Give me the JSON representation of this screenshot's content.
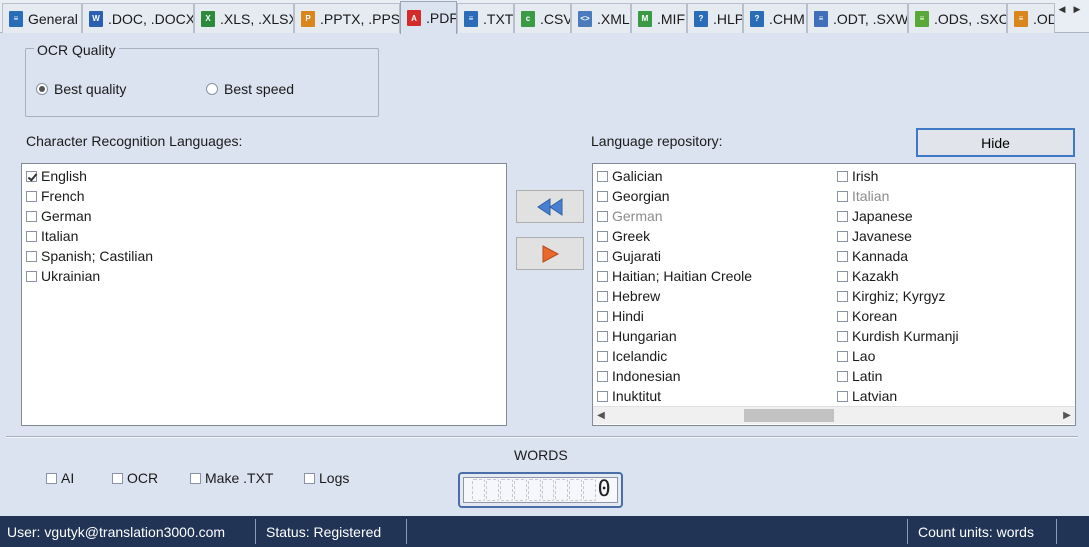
{
  "tabs": [
    {
      "label": "General",
      "icon": "document-icon",
      "color": "#2b6cb8"
    },
    {
      "label": ".DOC, .DOCX",
      "icon": "word-icon",
      "color": "#2b5fb0"
    },
    {
      "label": ".XLS, .XLSX",
      "icon": "excel-icon",
      "color": "#2e8a3c"
    },
    {
      "label": ".PPTX, .PPSX",
      "icon": "powerpoint-icon",
      "color": "#d9861c"
    },
    {
      "label": ".PDF",
      "icon": "pdf-icon",
      "color": "#d42a2a"
    },
    {
      "label": ".TXT",
      "icon": "txt-icon",
      "color": "#2b6cb8"
    },
    {
      "label": ".CSV",
      "icon": "csv-icon",
      "color": "#3c9a47"
    },
    {
      "label": ".XML",
      "icon": "xml-icon",
      "color": "#4b7bbd"
    },
    {
      "label": ".MIF",
      "icon": "mif-icon",
      "color": "#3c9a47"
    },
    {
      "label": ".HLP",
      "icon": "hlp-icon",
      "color": "#2b6cb8"
    },
    {
      "label": ".CHM",
      "icon": "chm-icon",
      "color": "#2b6cb8"
    },
    {
      "label": ".ODT, .SXW",
      "icon": "odt-icon",
      "color": "#3f6fb8"
    },
    {
      "label": ".ODS, .SXC",
      "icon": "ods-icon",
      "color": "#5aa83a"
    },
    {
      "label": ".OD",
      "icon": "odp-icon",
      "color": "#d9861c"
    }
  ],
  "ocr_quality": {
    "title": "OCR Quality",
    "options": [
      {
        "label": "Best quality",
        "selected": true
      },
      {
        "label": "Best speed",
        "selected": false
      }
    ]
  },
  "recognition": {
    "title": "Character Recognition Languages:",
    "items": [
      {
        "label": "English",
        "checked": true
      },
      {
        "label": "French",
        "checked": false
      },
      {
        "label": "German",
        "checked": false
      },
      {
        "label": "Italian",
        "checked": false
      },
      {
        "label": "Spanish; Castilian",
        "checked": false
      },
      {
        "label": "Ukrainian",
        "checked": false
      }
    ]
  },
  "repository": {
    "title": "Language repository:",
    "hide_label": "Hide",
    "col1": [
      {
        "label": "Galician",
        "disabled": false
      },
      {
        "label": "Georgian",
        "disabled": false
      },
      {
        "label": "German",
        "disabled": true
      },
      {
        "label": "Greek",
        "disabled": false
      },
      {
        "label": "Gujarati",
        "disabled": false
      },
      {
        "label": "Haitian; Haitian Creole",
        "disabled": false
      },
      {
        "label": "Hebrew",
        "disabled": false
      },
      {
        "label": "Hindi",
        "disabled": false
      },
      {
        "label": "Hungarian",
        "disabled": false
      },
      {
        "label": "Icelandic",
        "disabled": false
      },
      {
        "label": "Indonesian",
        "disabled": false
      },
      {
        "label": "Inuktitut",
        "disabled": false
      }
    ],
    "col2": [
      {
        "label": "Irish",
        "disabled": false
      },
      {
        "label": "Italian",
        "disabled": true
      },
      {
        "label": "Japanese",
        "disabled": false
      },
      {
        "label": "Javanese",
        "disabled": false
      },
      {
        "label": "Kannada",
        "disabled": false
      },
      {
        "label": "Kazakh",
        "disabled": false
      },
      {
        "label": "Kirghiz; Kyrgyz",
        "disabled": false
      },
      {
        "label": "Korean",
        "disabled": false
      },
      {
        "label": "Kurdish Kurmanji",
        "disabled": false
      },
      {
        "label": "Lao",
        "disabled": false
      },
      {
        "label": "Latin",
        "disabled": false
      },
      {
        "label": "Latvian",
        "disabled": false
      }
    ]
  },
  "options": [
    {
      "label": "AI",
      "checked": false
    },
    {
      "label": "OCR",
      "checked": false
    },
    {
      "label": "Make .TXT",
      "checked": false
    },
    {
      "label": "Logs",
      "checked": false
    }
  ],
  "counter": {
    "title": "WORDS",
    "value": "0"
  },
  "status": {
    "user": "User: vgutyk@translation3000.com",
    "state": "Status: Registered",
    "units": "Count units: words"
  },
  "colors": {
    "statusbar": "#213455",
    "accent": "#3f78c4",
    "add_arrow": "#4a7fd0",
    "remove_arrow": "#e86a2c"
  }
}
